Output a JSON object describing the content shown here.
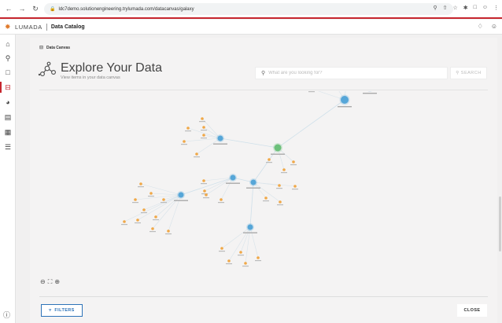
{
  "browser": {
    "url": "ldc7demo.solutionengineering.trylumada.com/datacanvas/galaxy",
    "nav_icons": [
      "arrow-left-icon",
      "arrow-right-icon",
      "reload-icon",
      "home-icon"
    ],
    "right_icons": [
      "zoom-icon",
      "share-icon",
      "star-icon",
      "extension-icon",
      "sidebar-icon",
      "profile-icon",
      "more-icon"
    ]
  },
  "app": {
    "logo": "LUMADA",
    "title": "Data Catalog"
  },
  "rail": {
    "items": [
      "home-icon",
      "search-icon",
      "bookmark-icon",
      "data-canvas-icon",
      "dashboard-icon",
      "document-icon",
      "briefcase-icon",
      "list-icon"
    ],
    "active_index": 3
  },
  "breadcrumb": {
    "label": "Data Canvas"
  },
  "hero": {
    "title": "Explore Your Data",
    "subtitle": "View items in your data canvas"
  },
  "search": {
    "placeholder": "What are you looking for?",
    "button_label": "SEARCH"
  },
  "controls": {
    "filters_label": "FILTERS",
    "close_label": "CLOSE"
  },
  "colors": {
    "accent_red": "#c6262e",
    "accent_blue": "#2d73b8",
    "node_orange": "#f0a848",
    "node_blue": "#56a6d8",
    "node_green": "#6cc07a",
    "node_dark_blue": "#2a6fc9"
  }
}
